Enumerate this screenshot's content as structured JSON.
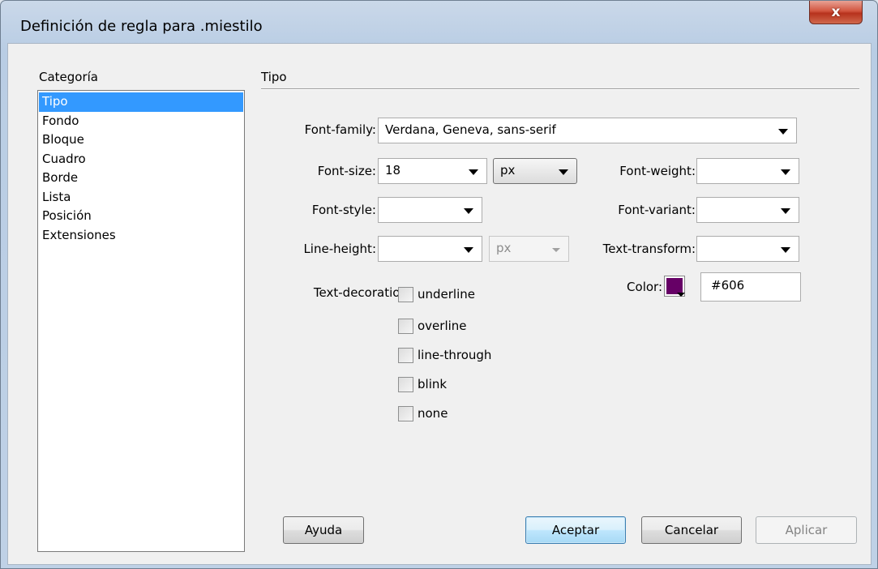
{
  "window": {
    "title": "Definición de regla para .miestilo",
    "close_label": "x"
  },
  "category": {
    "label": "Categoría",
    "items": [
      "Tipo",
      "Fondo",
      "Bloque",
      "Cuadro",
      "Borde",
      "Lista",
      "Posición",
      "Extensiones"
    ],
    "selected": "Tipo"
  },
  "section": {
    "title": "Tipo"
  },
  "fields": {
    "font_family": {
      "label": "Font-family:",
      "value": "Verdana, Geneva, sans-serif"
    },
    "font_size": {
      "label": "Font-size:",
      "value": "18",
      "unit": "px"
    },
    "font_weight": {
      "label": "Font-weight:",
      "value": ""
    },
    "font_style": {
      "label": "Font-style:",
      "value": ""
    },
    "font_variant": {
      "label": "Font-variant:",
      "value": ""
    },
    "line_height": {
      "label": "Line-height:",
      "value": "",
      "unit": "px"
    },
    "text_transform": {
      "label": "Text-transform:",
      "value": ""
    },
    "text_decoration": {
      "label": "Text-decoration:",
      "options": [
        "underline",
        "overline",
        "line-through",
        "blink",
        "none"
      ]
    },
    "color": {
      "label": "Color:",
      "value": "#606",
      "swatch": "#660066"
    }
  },
  "buttons": {
    "help": "Ayuda",
    "ok": "Aceptar",
    "cancel": "Cancelar",
    "apply": "Aplicar"
  }
}
